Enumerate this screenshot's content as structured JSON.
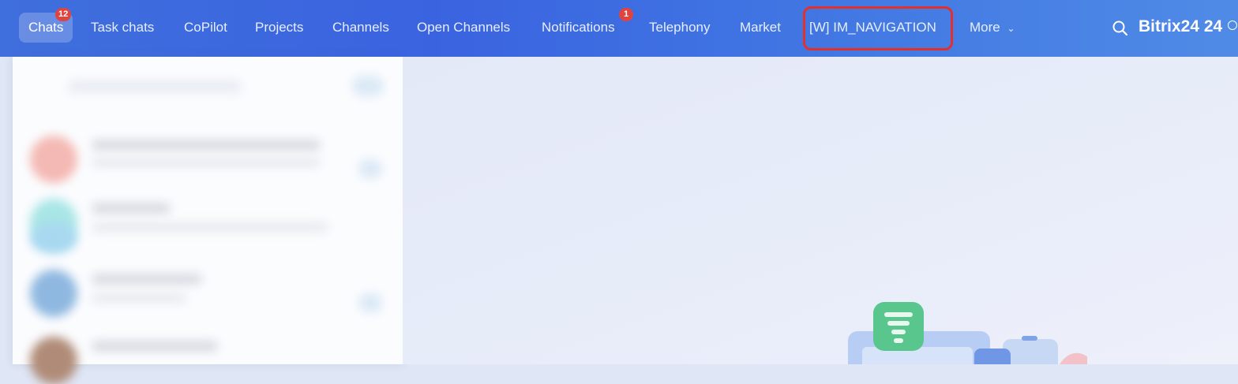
{
  "topbar": {
    "items": [
      {
        "label": "Chats",
        "badge": "12",
        "active": true
      },
      {
        "label": "Task chats"
      },
      {
        "label": "CoPilot"
      },
      {
        "label": "Projects"
      },
      {
        "label": "Channels"
      },
      {
        "label": "Open Channels"
      },
      {
        "label": "Notifications",
        "badge": "1"
      },
      {
        "label": "Telephony"
      },
      {
        "label": "Market"
      },
      {
        "label": "[W] IM_NAVIGATION",
        "highlighted": true
      },
      {
        "label": "More"
      }
    ],
    "brand": "Bitrix24 24",
    "colors": {
      "bar": "#3f6fdc",
      "badge": "#e0443e",
      "highlight": "#e3302b"
    }
  },
  "icons": [
    "search-icon",
    "chevron-down-icon",
    "clock-icon",
    "filter-icon"
  ]
}
